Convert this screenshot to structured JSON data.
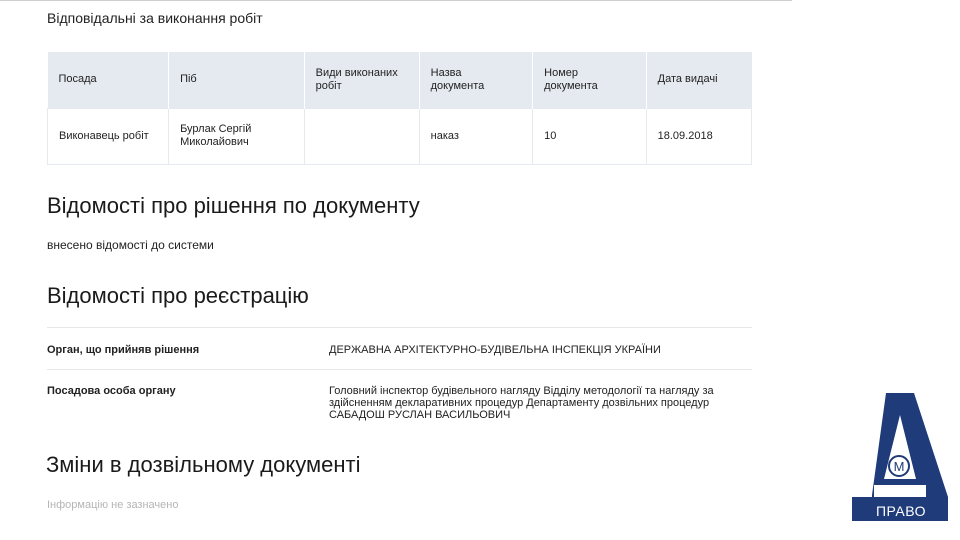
{
  "responsible": {
    "title": "Відповідальні за виконання робіт",
    "columns": [
      "Посада",
      "Піб",
      "Види виконаних робіт",
      "Назва документа",
      "Номер документа",
      "Дата видачі"
    ],
    "rows": [
      {
        "position": "Виконавець робіт",
        "name": "Бурлак Сергій Миколайович",
        "work_types": "",
        "doc_name": "наказ",
        "doc_number": "10",
        "issue_date": "18.09.2018"
      }
    ]
  },
  "decision": {
    "title": "Відомості про рішення по документу",
    "text": "внесено відомості до системи"
  },
  "registration": {
    "title": "Відомості про реєстрацію",
    "rows": [
      {
        "label": "Орган, що прийняв рішення",
        "value": "ДЕРЖАВНА АРХІТЕКТУРНО-БУДІВЕЛЬНА ІНСПЕКЦІЯ УКРАЇНИ"
      },
      {
        "label": "Посадова особа органу",
        "value": "Головний інспектор будівельного нагляду Відділу методології та нагляду за здійсненням декларативних процедур Департаменту дозвільних процедур САБАДОШ РУСЛАН ВАСИЛЬОВИЧ"
      }
    ]
  },
  "changes": {
    "title": "Зміни в дозвільному документі",
    "empty_text": "Інформацію не зазначено"
  },
  "logo": {
    "text": "ПРАВО",
    "letter": "М",
    "color": "#1f3b7a"
  }
}
